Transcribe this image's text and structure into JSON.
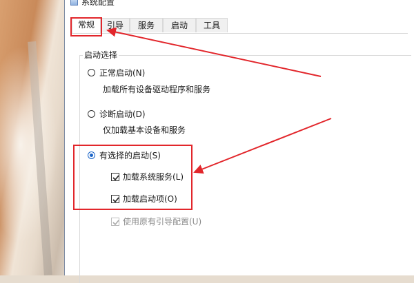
{
  "window": {
    "title": "系统配置"
  },
  "tabs": [
    {
      "label": "常规",
      "active": true
    },
    {
      "label": "引导",
      "active": false
    },
    {
      "label": "服务",
      "active": false
    },
    {
      "label": "启动",
      "active": false
    },
    {
      "label": "工具",
      "active": false
    }
  ],
  "startup_group": {
    "legend": "启动选择",
    "normal": {
      "label": "正常启动(N)",
      "desc": "加载所有设备驱动程序和服务",
      "selected": false
    },
    "diagnostic": {
      "label": "诊断启动(D)",
      "desc": "仅加载基本设备和服务",
      "selected": false
    },
    "selective": {
      "label": "有选择的启动(S)",
      "selected": true
    },
    "options": {
      "load_system_services": {
        "label": "加载系统服务(L)",
        "checked": true
      },
      "load_startup_items": {
        "label": "加载启动项(O)",
        "checked": true
      },
      "use_original_boot": {
        "label": "使用原有引导配置(U)",
        "checked": true,
        "disabled": true
      }
    }
  },
  "colors": {
    "annotation": "#e2262b",
    "accent": "#1a64c8"
  },
  "icons": [
    "window-icon",
    "check-icon",
    "arrow-icon"
  ]
}
